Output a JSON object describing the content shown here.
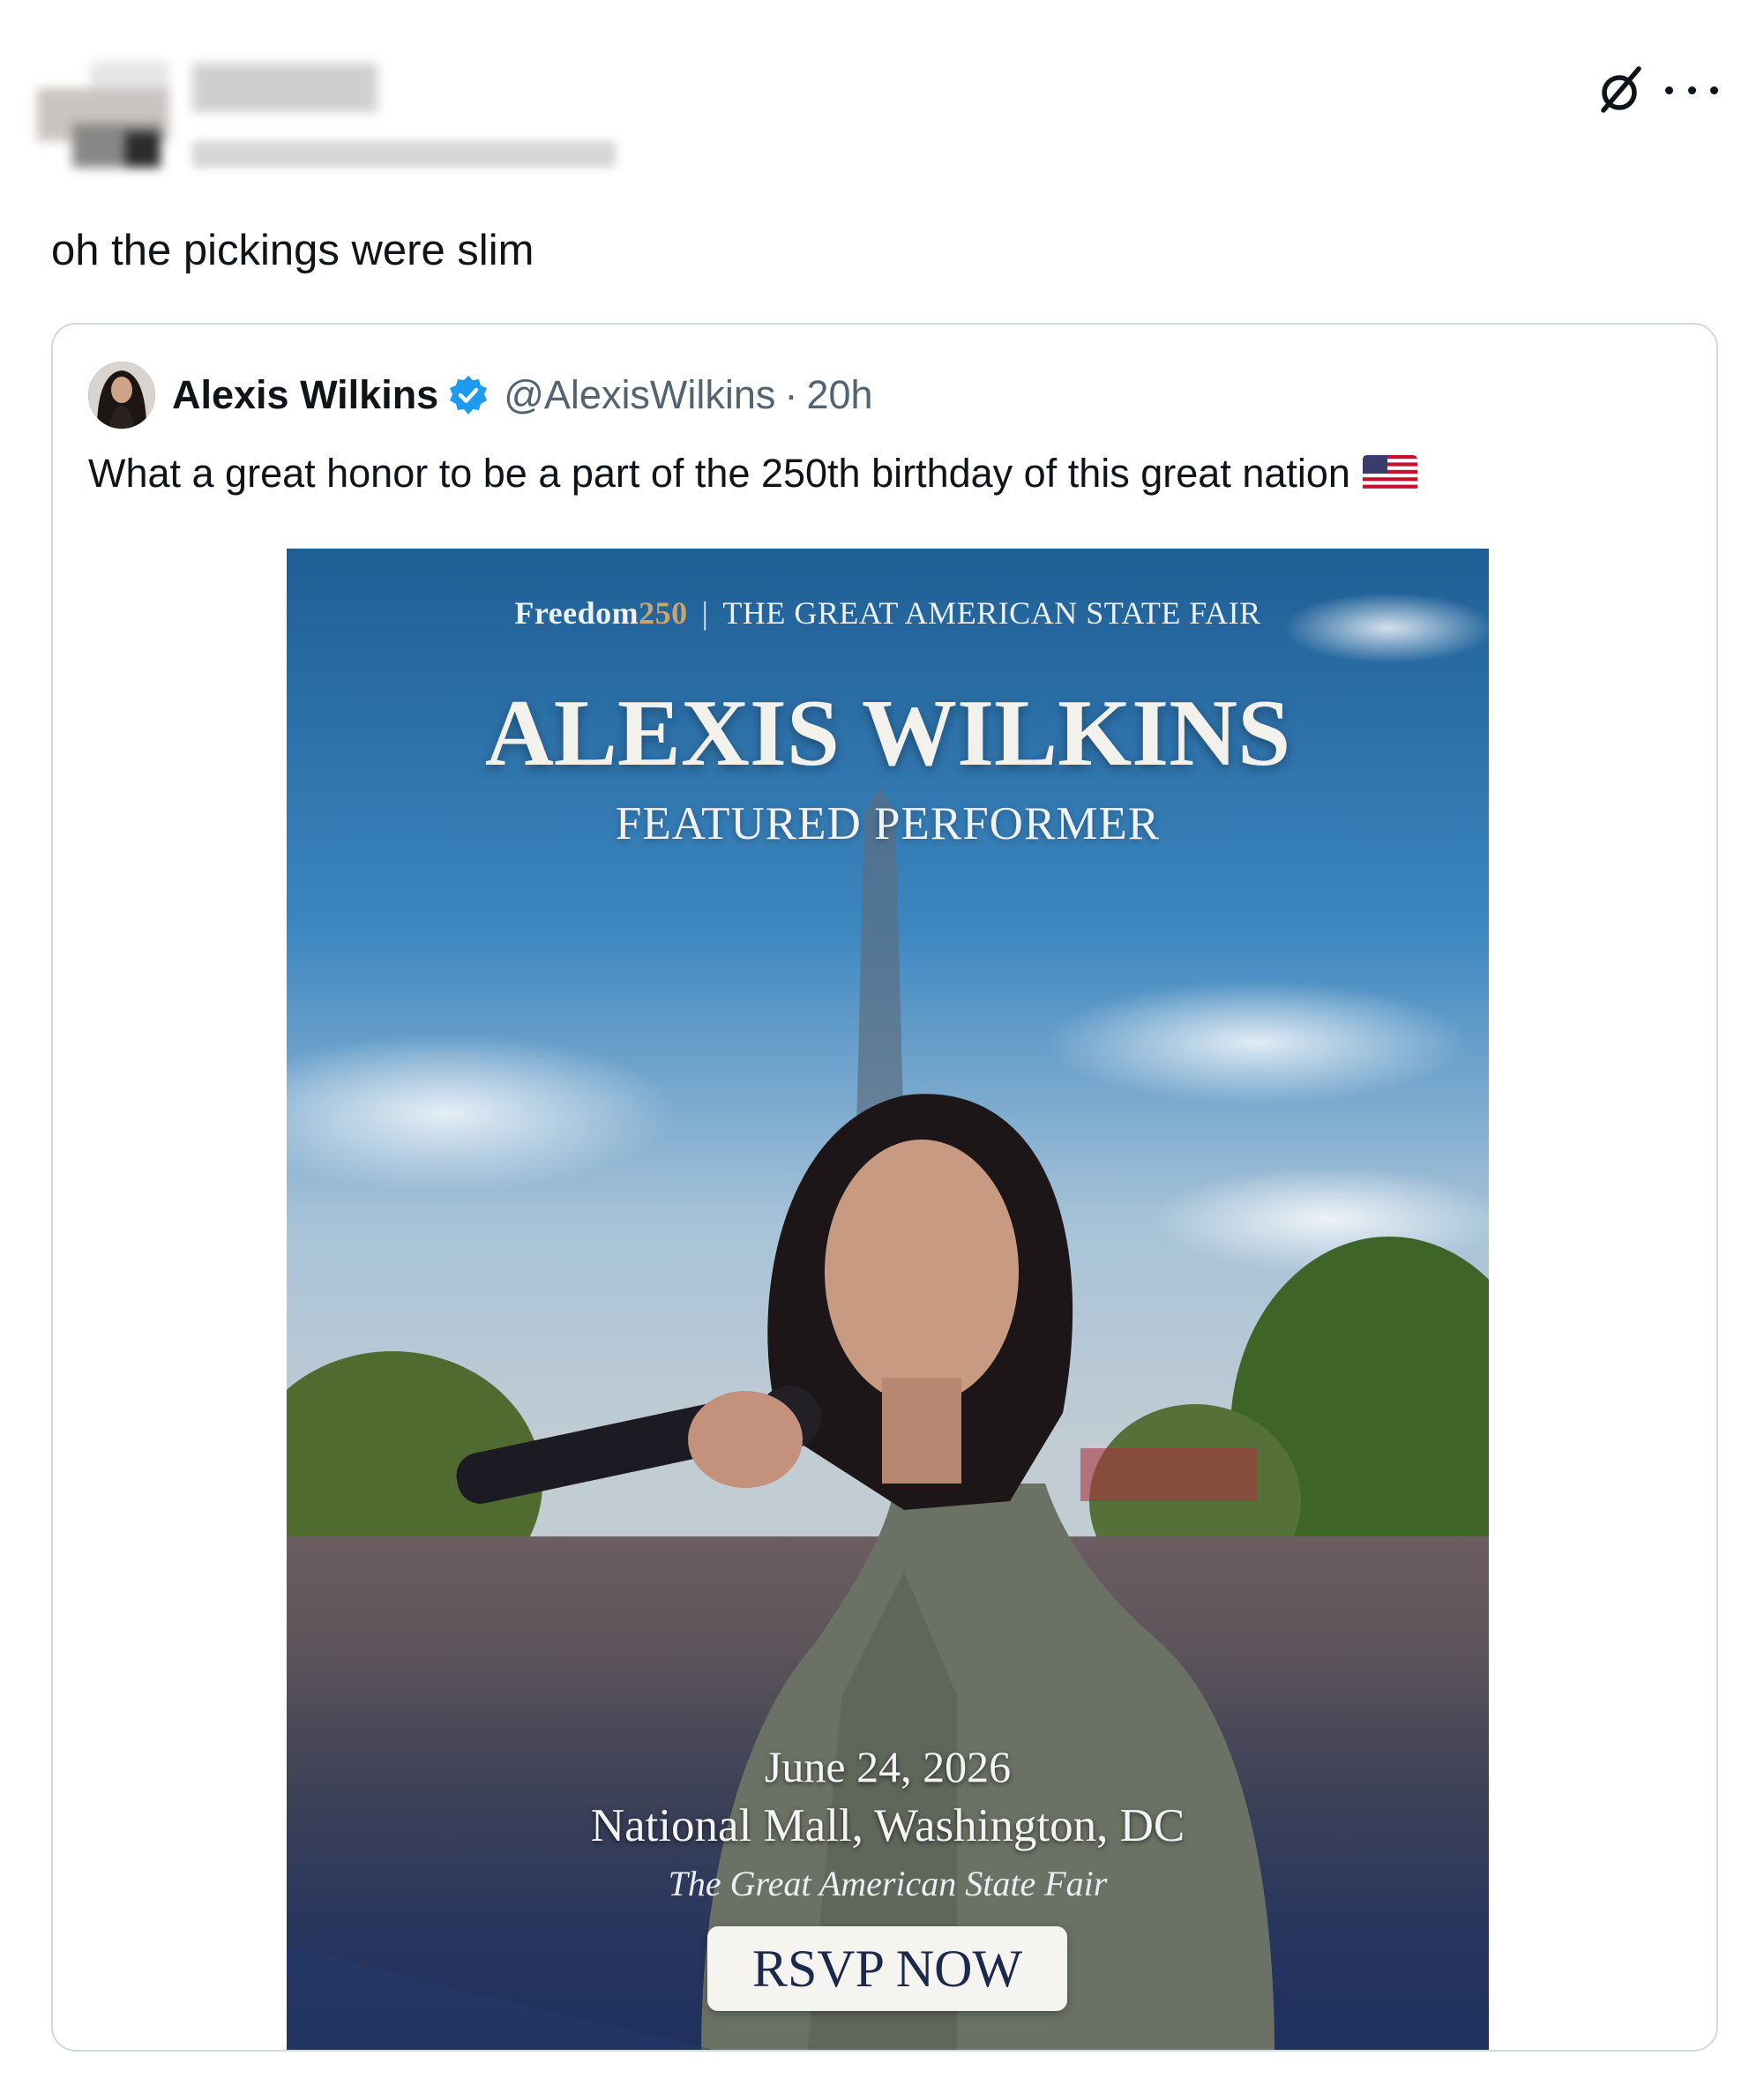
{
  "tweet": {
    "text": "oh the pickings were slim"
  },
  "quoted": {
    "author_name": "Alexis Wilkins",
    "handle": "@AlexisWilkins",
    "separator": "·",
    "time": "20h",
    "text": "What a great honor to be a part of the 250th birthday of this great nation",
    "emoji": "us-flag"
  },
  "poster": {
    "brand_word": "Freedom",
    "brand_number": "250",
    "divider": "|",
    "top_label": "THE GREAT AMERICAN STATE FAIR",
    "performer_name": "ALEXIS WILKINS",
    "role": "FEATURED PERFORMER",
    "date": "June 24, 2026",
    "location": "National Mall, Washington, DC",
    "event_name": "The Great American State Fair",
    "cta": "RSVP NOW"
  },
  "icons": {
    "grok": "grok-icon",
    "more": "more-icon",
    "verified": "verified-badge-icon"
  },
  "colors": {
    "verified_blue": "#1d9bf0",
    "handle_gray": "#536471",
    "border": "#cfd9de",
    "cta_text": "#1b2a4a"
  }
}
